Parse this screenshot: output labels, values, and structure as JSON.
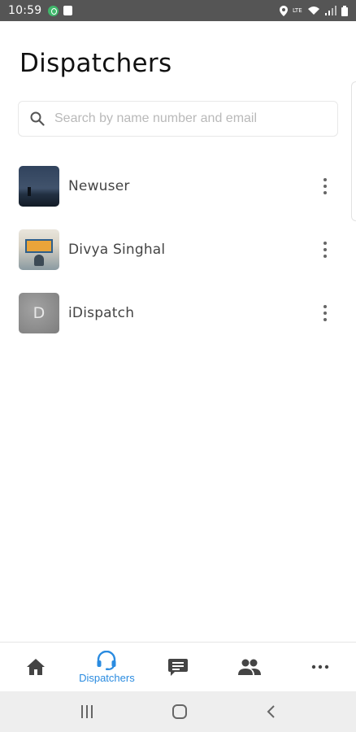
{
  "status_bar": {
    "time": "10:59",
    "network_label": "LTE"
  },
  "page": {
    "title": "Dispatchers"
  },
  "search": {
    "placeholder": "Search by name number and email",
    "value": ""
  },
  "dispatchers": [
    {
      "name": "Newuser",
      "avatar": "photo-night-sky"
    },
    {
      "name": "Divya Singhal",
      "avatar": "photo-signboard"
    },
    {
      "name": "iDispatch",
      "avatar": "initial",
      "initial": "D"
    }
  ],
  "bottom_nav": {
    "items": [
      {
        "icon": "home-icon",
        "label": ""
      },
      {
        "icon": "headset-icon",
        "label": "Dispatchers",
        "active": true
      },
      {
        "icon": "chat-icon",
        "label": ""
      },
      {
        "icon": "people-icon",
        "label": ""
      },
      {
        "icon": "more-icon",
        "label": ""
      }
    ]
  },
  "colors": {
    "accent": "#2a8be0",
    "status_bar": "#555555",
    "system_nav": "#eeeeee"
  }
}
